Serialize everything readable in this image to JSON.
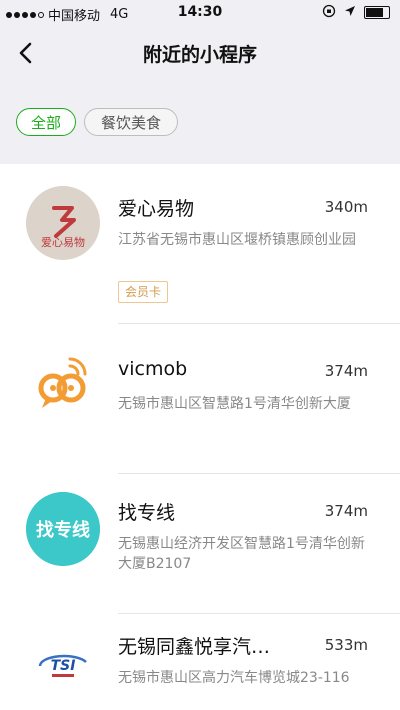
{
  "status": {
    "carrier": "中国移动",
    "network": "4G",
    "time": "14:30"
  },
  "nav": {
    "title": "附近的小程序"
  },
  "filters": [
    "全部",
    "餐饮美食"
  ],
  "items": [
    {
      "name": "爱心易物",
      "distance": "340m",
      "address": "江苏省无锡市惠山区堰桥镇惠顾创业园",
      "badge": "会员卡",
      "logo_text": "爱心易物"
    },
    {
      "name": "vicmob",
      "distance": "374m",
      "address": "无锡市惠山区智慧路1号清华创新大厦"
    },
    {
      "name": "找专线",
      "distance": "374m",
      "address": "无锡惠山经济开发区智慧路1号清华创新大厦B2107",
      "logo_text": "找专线"
    },
    {
      "name": "无锡同鑫悦享汽…",
      "distance": "533m",
      "address": "无锡市惠山区高力汽车博览城23-116",
      "logo_text": "TSI"
    }
  ],
  "colors": {
    "accent": "#1aad19",
    "badge": "#d19c4c",
    "vicmob_orange": "#f39c34",
    "zhuanxian_teal": "#3cc8c8"
  }
}
